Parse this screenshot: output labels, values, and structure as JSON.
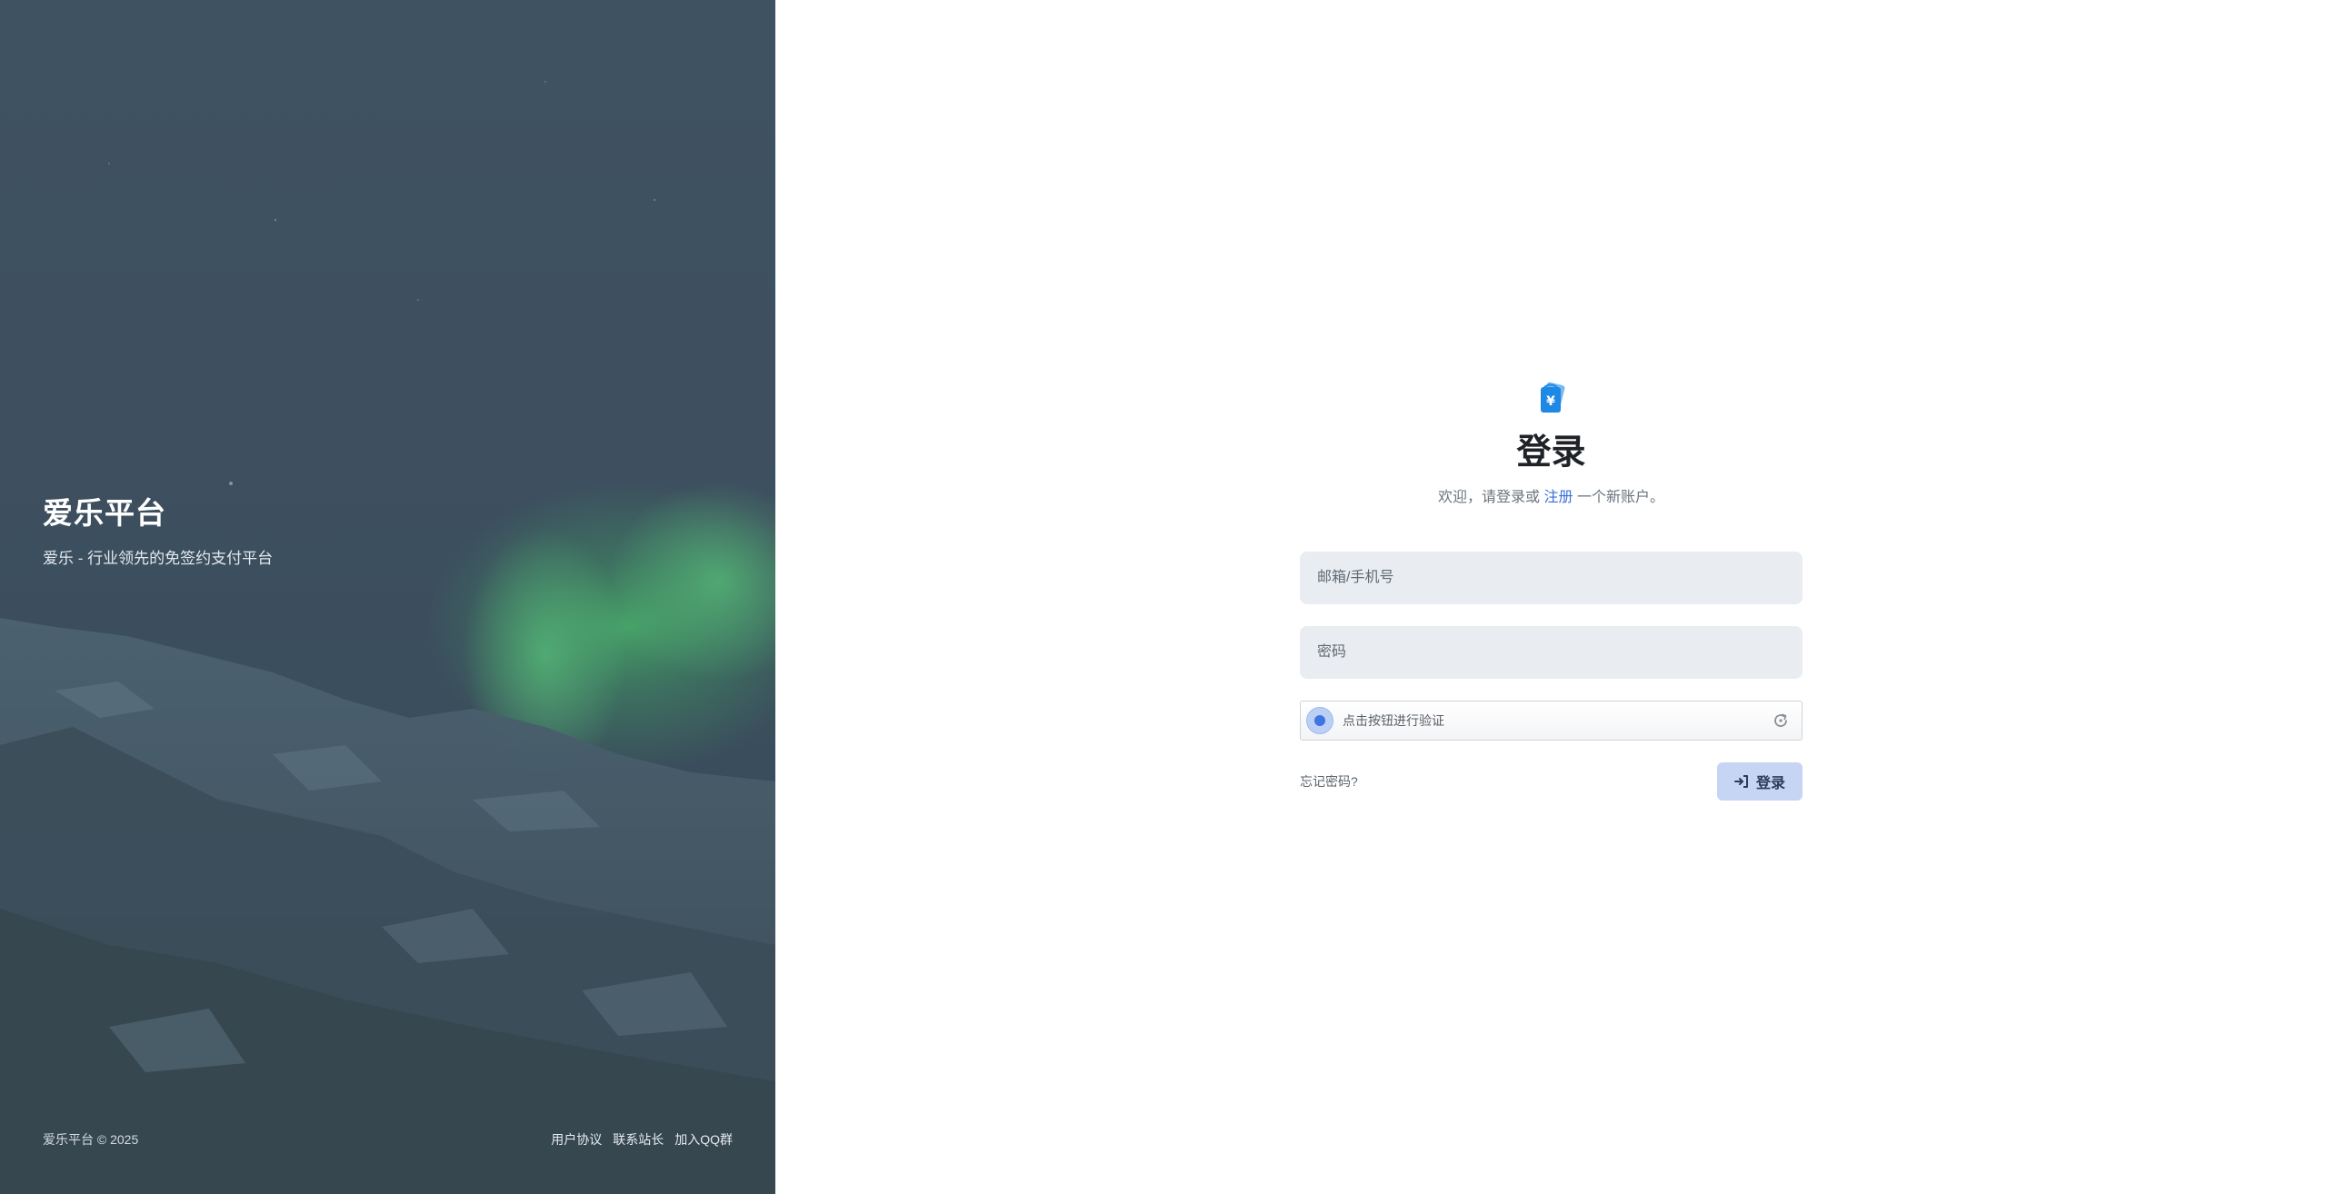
{
  "brand": {
    "title": "爱乐平台",
    "subtitle": "爱乐 - 行业领先的免签约支付平台"
  },
  "footer": {
    "copyright": "爱乐平台 © 2025",
    "links": [
      "用户协议",
      "联系站长",
      "加入QQ群"
    ]
  },
  "login": {
    "logo_icon": "yen-wallet-icon",
    "title": "登录",
    "desc_prefix": "欢迎，请登录或",
    "register_link": "注册",
    "desc_suffix": "一个新账户。",
    "email_placeholder": "邮箱/手机号",
    "password_placeholder": "密码",
    "captcha_text": "点击按钮进行验证",
    "forgot_label": "忘记密码?",
    "submit_label": "登录"
  },
  "colors": {
    "accent": "#3b6fd6",
    "left_bg": "#3e5060",
    "aurora": "#3fa36a",
    "button_bg": "#c6d5f4"
  }
}
